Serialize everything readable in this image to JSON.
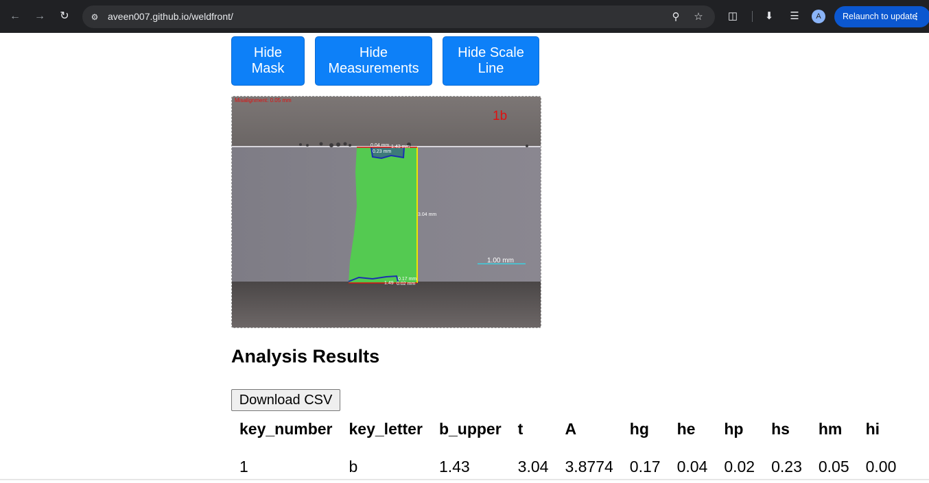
{
  "browser": {
    "url": "aveen007.github.io/weldfront/",
    "relaunch_label": "Relaunch to update",
    "avatar_letter": "A"
  },
  "controls": {
    "hide_mask": "Hide Mask",
    "hide_measurements": "Hide Measurements",
    "hide_scale_line": "Hide Scale Line"
  },
  "image": {
    "misalignment": "Misalignment: 0.05 mm",
    "sample_label": "1b",
    "m_top_a": "0.04 mm",
    "m_top_b": "1.43 mm",
    "m_top_c": "0.23 mm",
    "m_thickness": "3.04 mm",
    "m_bottom_a": "0.17 mm",
    "m_bottom_b": "1.49",
    "m_bottom_c": "0.02 mm",
    "scale": "1.00 mm"
  },
  "results": {
    "heading": "Analysis Results",
    "download_label": "Download CSV",
    "columns": [
      "key_number",
      "key_letter",
      "b_upper",
      "t",
      "A",
      "hg",
      "he",
      "hp",
      "hs",
      "hm",
      "hi"
    ],
    "rows": [
      [
        "1",
        "b",
        "1.43",
        "3.04",
        "3.8774",
        "0.17",
        "0.04",
        "0.02",
        "0.23",
        "0.05",
        "0.00"
      ]
    ]
  },
  "colors": {
    "button_blue": "#0d80f8",
    "chrome_bg": "#202124",
    "mask_green": "#4fd24a",
    "label_red": "#e01010"
  }
}
